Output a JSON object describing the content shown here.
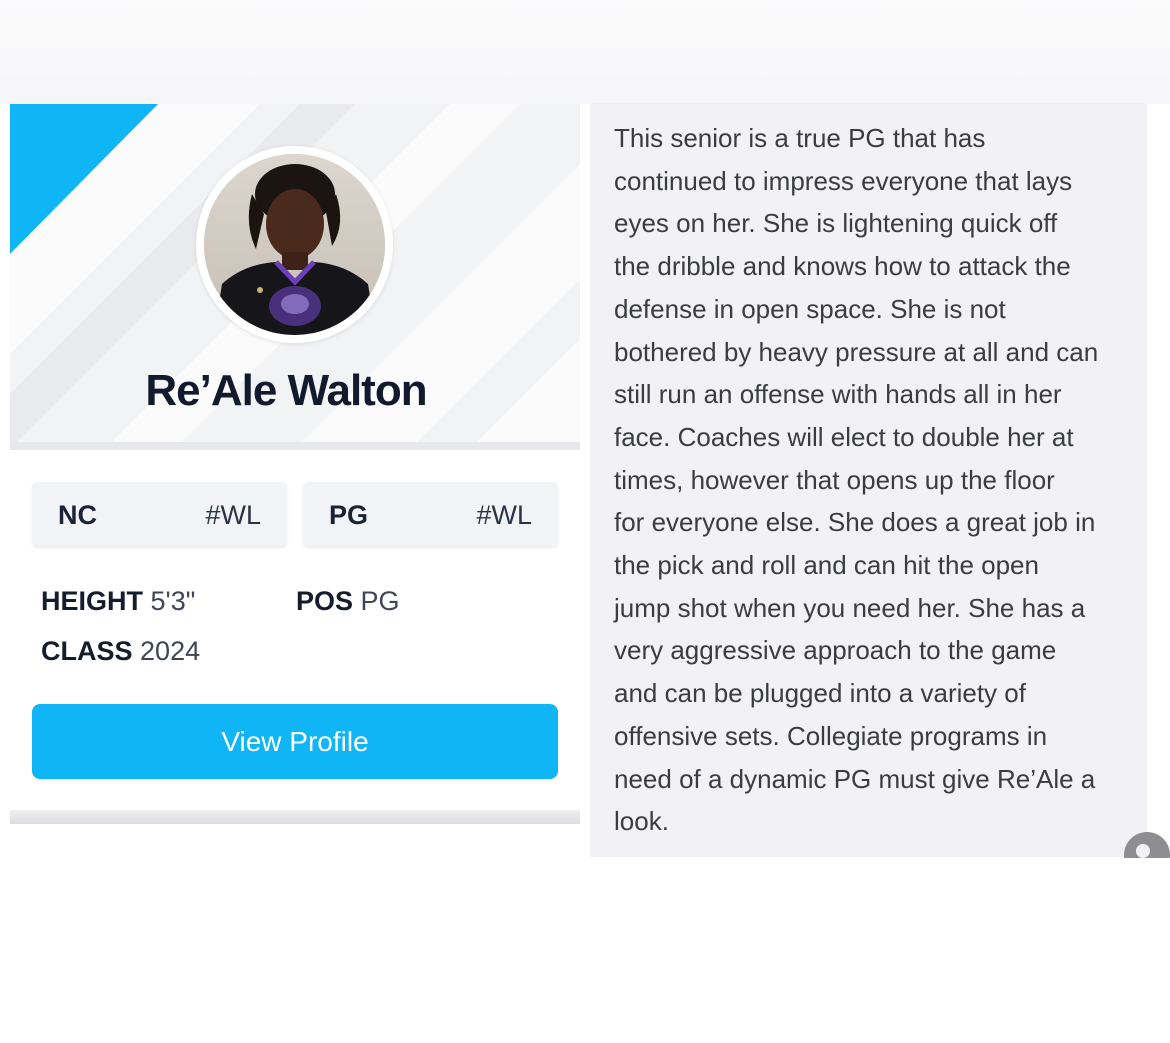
{
  "player": {
    "name": "Re’Ale Walton",
    "photo_icon": "player-photo"
  },
  "chips": [
    {
      "label": "NC",
      "tag": "#WL"
    },
    {
      "label": "PG",
      "tag": "#WL"
    }
  ],
  "stats": {
    "height_label": "HEIGHT",
    "height_value": "5'3\"",
    "pos_label": "POS",
    "pos_value": "PG",
    "class_label": "CLASS",
    "class_value": "2024"
  },
  "button": {
    "label": "View Profile"
  },
  "description": "This senior is a true PG that has\ncontinued to impress everyone that lays\neyes on her. She is lightening quick off\nthe dribble and knows how to attack the\ndefense in open space. She is not\nbothered by heavy pressure at all and can\nstill run an offense with hands all in her\nface. Coaches will elect to double her at\ntimes, however that opens up the floor\nfor everyone else. She does a great job in\nthe pick and roll and can hit the open\njump shot when you need her. She has a\nvery aggressive approach to the game\nand can be plugged into a variety of\noffensive sets. Collegiate programs in\nneed of a dynamic PG must give Re’Ale a\nlook.",
  "colors": {
    "accent": "#0fb5f4",
    "name_text": "#121a2e",
    "panel_bg": "#f2f2f4"
  }
}
